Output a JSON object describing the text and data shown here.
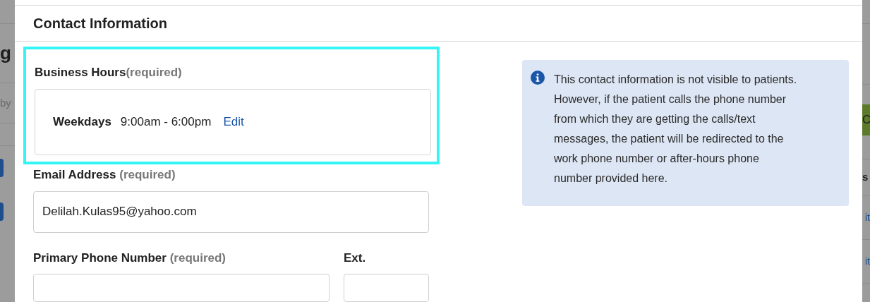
{
  "background_left": {
    "heading_fragment": "g",
    "text_fragment": "by"
  },
  "background_right": {
    "button_fragment": "C",
    "heading_fragment": "s",
    "links": [
      "it",
      "it"
    ]
  },
  "modal": {
    "title": "Contact Information",
    "business_hours": {
      "label": "Business Hours",
      "required": "(required)",
      "highlighted": true,
      "entries": [
        {
          "day": "Weekdays",
          "hours": "9:00am - 6:00pm",
          "action": "Edit"
        }
      ]
    },
    "email": {
      "label": "Email Address",
      "required": "(required)",
      "value": "Delilah.Kulas95@yahoo.com"
    },
    "phone": {
      "label": "Primary Phone Number",
      "required": "(required)",
      "ext_label": "Ext."
    },
    "notice": "This contact information is not visible to patients. However, if the patient calls the phone number from which they are getting the calls/text messages, the patient will be redirected to the work phone number or after-hours phone number provided here."
  }
}
